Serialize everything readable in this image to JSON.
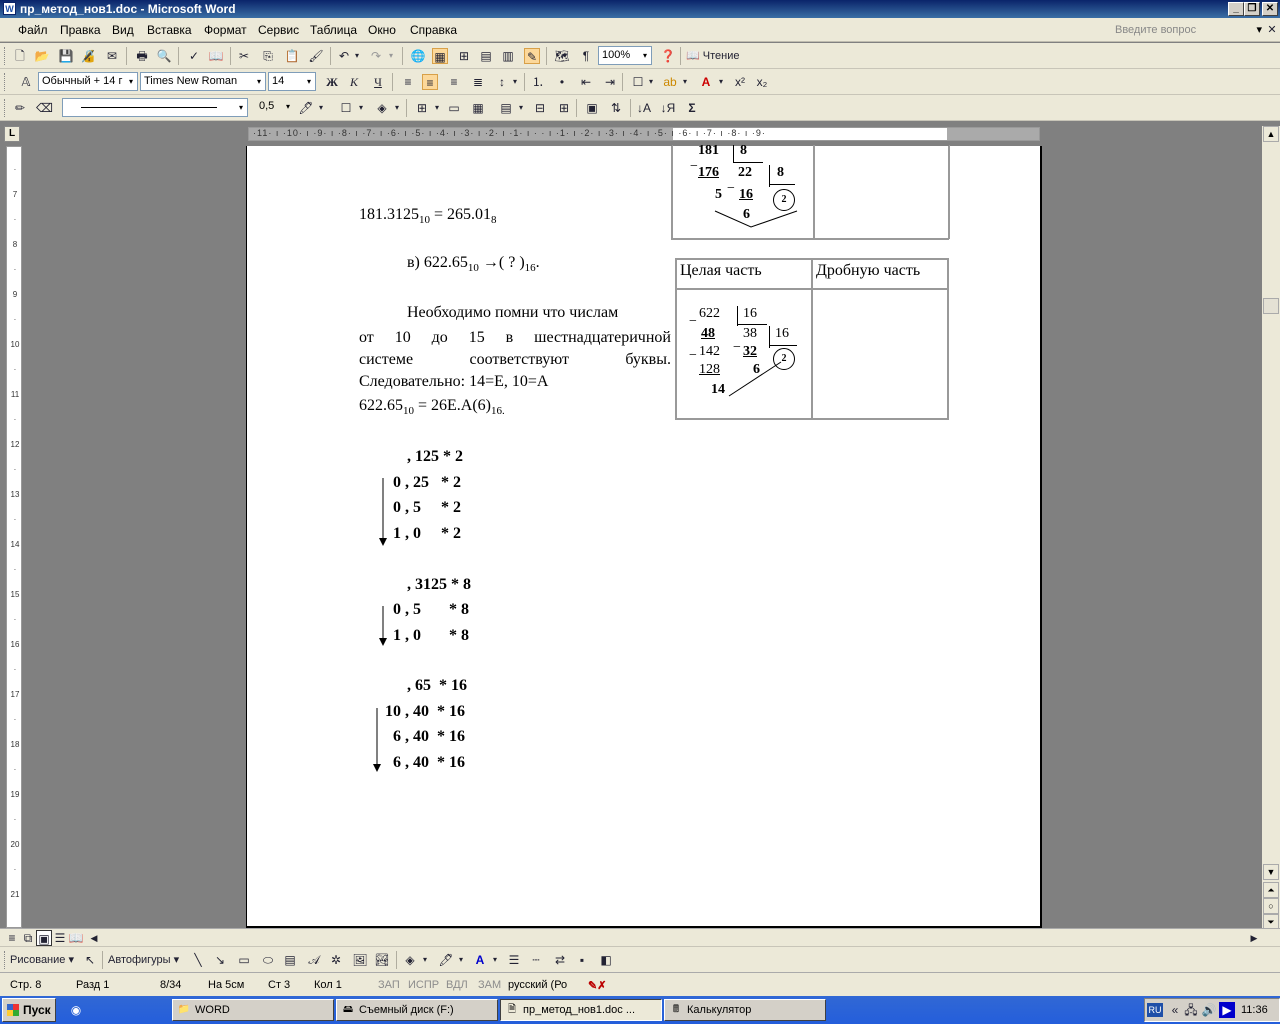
{
  "window": {
    "title": "пр_метод_нов1.doc - Microsoft Word"
  },
  "menu": {
    "items": [
      "Файл",
      "Правка",
      "Вид",
      "Вставка",
      "Формат",
      "Сервис",
      "Таблица",
      "Окно",
      "Справка"
    ],
    "ask_placeholder": "Введите вопрос"
  },
  "toolbar": {
    "zoom": "100%",
    "read_label": "Чтение",
    "style": "Обычный + 14 г",
    "font": "Times New Roman",
    "size": "14",
    "line_width": "0,5"
  },
  "document": {
    "line1": "181.3125",
    "line1_sub1": "10",
    "line1_mid": " = 265.01",
    "line1_sub2": "8",
    "line2_a": "в) 622.65",
    "line2_sub": "10",
    "line2_b": "  →( ? )",
    "line2_sub2": "16",
    "line2_end": ".",
    "para1": "Необходимо помни что числам",
    "para2a": "от",
    "para2b": "10",
    "para2c": "до",
    "para2d": "15",
    "para2e": "в",
    "para2f": "шестнадцатеричной",
    "para3a": "системе",
    "para3b": "соответствуют",
    "para3c": "буквы.",
    "para4": "Следовательно:  14=Е, 10=А",
    "line5a": "622.65",
    "line5_sub": "10",
    "line5b": " = 26Е.А(6)",
    "line5_sub2": "16.",
    "calc1": [
      ", 125 * 2",
      "0 , 25   * 2",
      "0 , 5     * 2",
      "1 , 0     * 2"
    ],
    "calc2": [
      ", 3125 * 8",
      "0 , 5       * 8",
      "1 , 0       * 8"
    ],
    "calc3": [
      ", 65  * 16",
      "10 , 40  * 16",
      "6 , 40  * 16",
      "6 , 40  * 16"
    ],
    "table2_head1": "Целая часть",
    "table2_head2": "Дробную часть",
    "div1": {
      "a": "181",
      "b": "8",
      "c": "176",
      "d": "22",
      "e": "8",
      "f": "5",
      "g": "16",
      "h": "2",
      "i": "6"
    },
    "div2": {
      "a": "622",
      "b": "16",
      "c": "48",
      "d": "38",
      "e": "16",
      "f": "142",
      "g": "32",
      "h": "2",
      "i": "128",
      "j": "6",
      "k": "14"
    }
  },
  "status": {
    "page": "Стр. 8",
    "section": "Разд 1",
    "pages": "8/34",
    "at": "На 5см",
    "line": "Ст 3",
    "col": "Кол 1",
    "rec": "ЗАП",
    "trk": "ИСПР",
    "ext": "ВДЛ",
    "ovr": "ЗАМ",
    "lang": "русский (Ро"
  },
  "drawbar": {
    "draw_label": "Рисование",
    "autoshapes_label": "Автофигуры"
  },
  "taskbar": {
    "start": "Пуск",
    "tasks": [
      "WORD",
      "Съемный диск (F:)",
      "пр_метод_нов1.doc ...",
      "Калькулятор"
    ],
    "lang": "RU",
    "clock": "11:36"
  }
}
